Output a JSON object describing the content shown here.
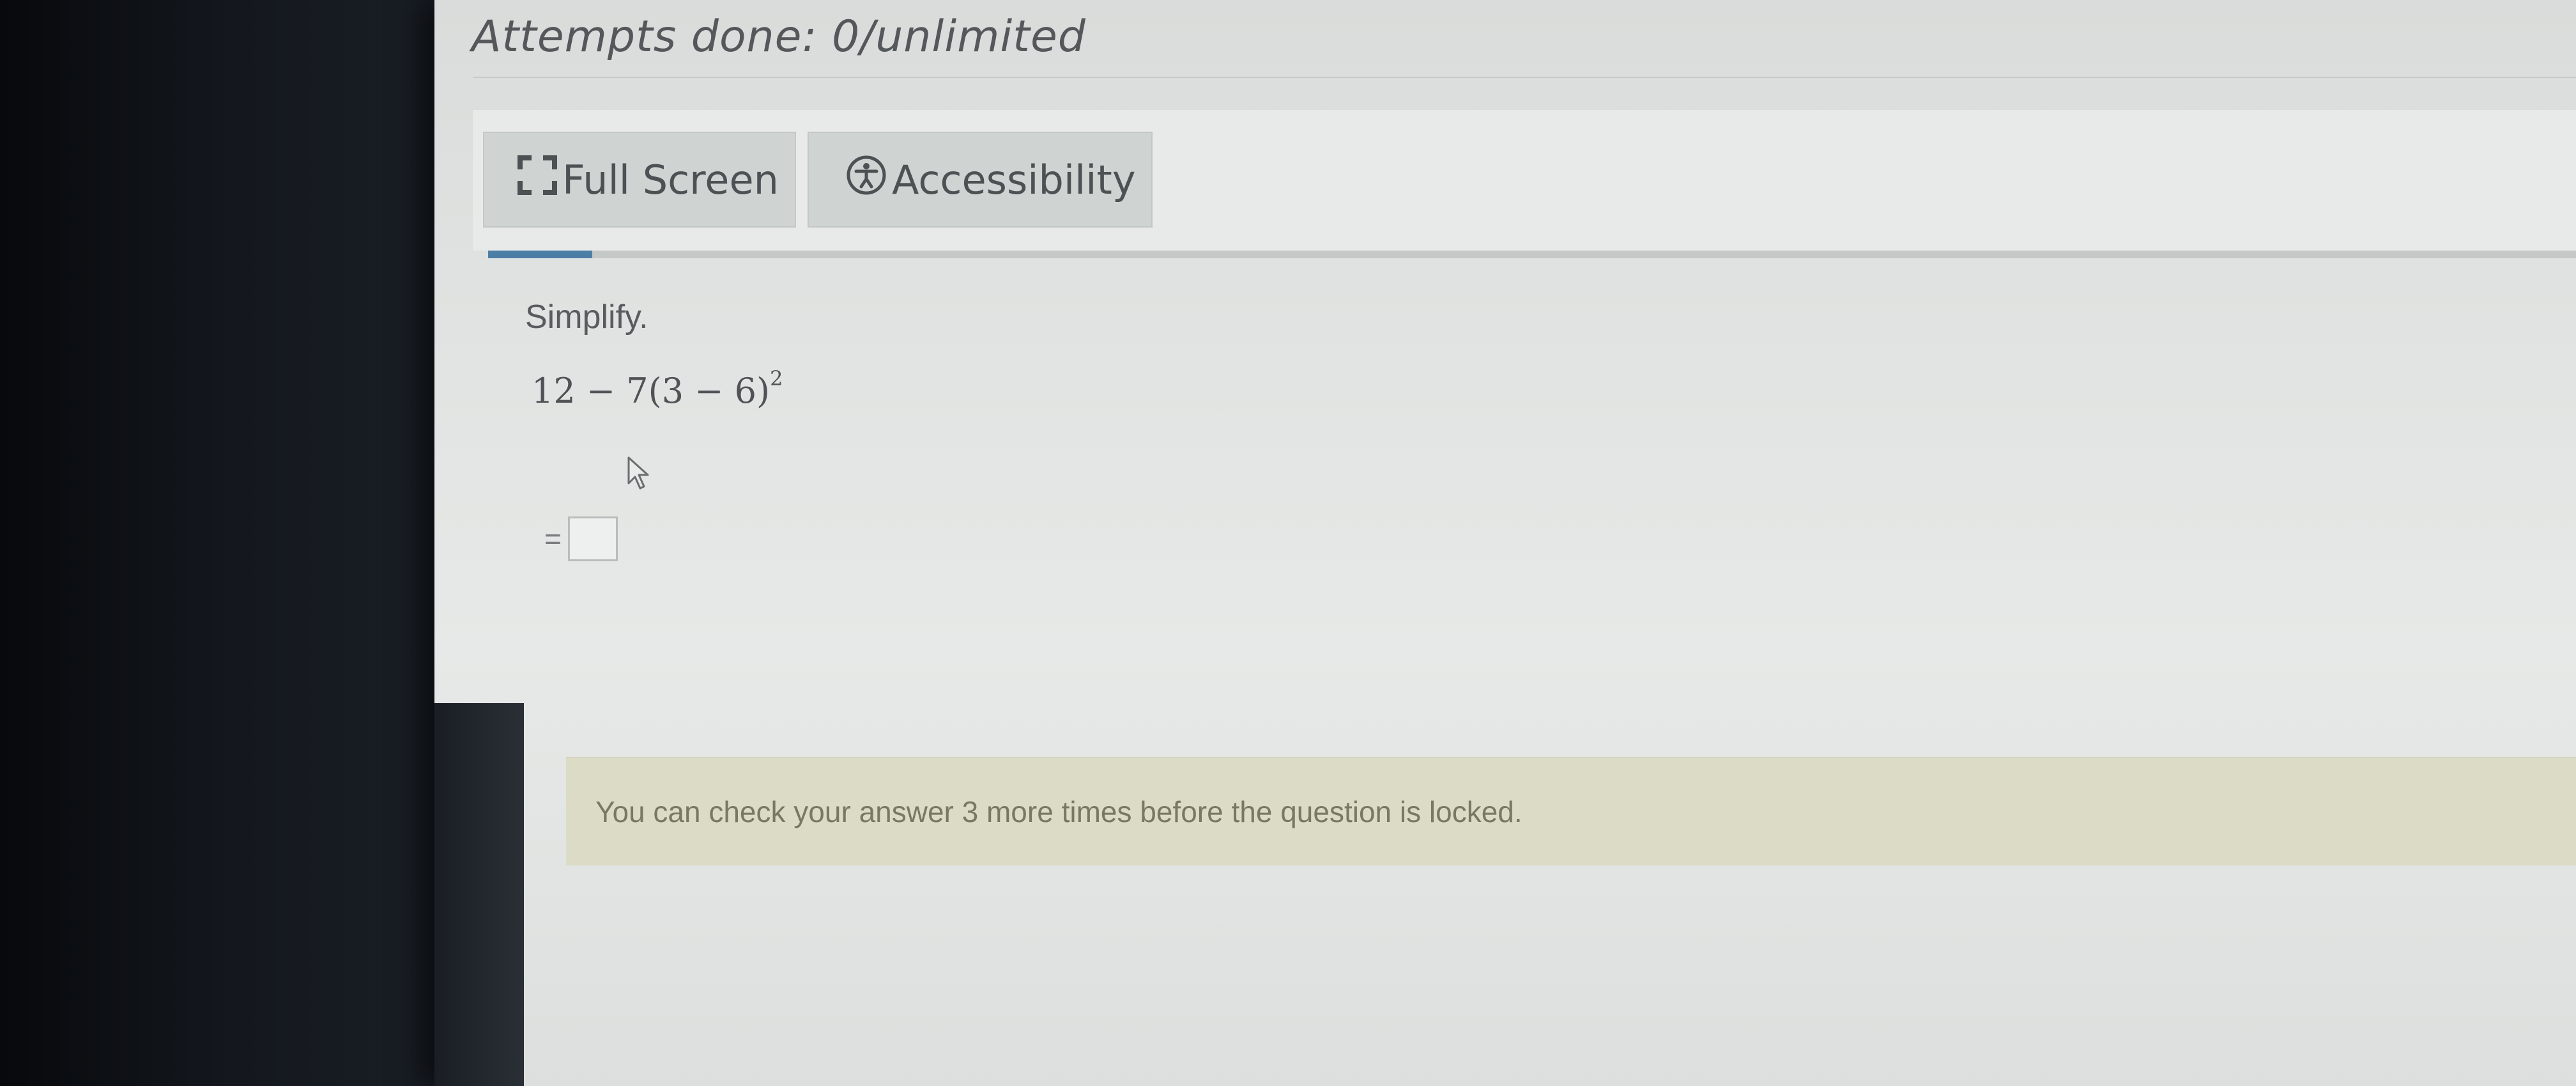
{
  "header": {
    "attempts_text": "Attempts done: 0/unlimited"
  },
  "toolbar": {
    "full_screen_label": "Full Screen",
    "full_screen_icon": "fullscreen-icon",
    "accessibility_label": "Accessibility",
    "accessibility_icon": "accessibility-icon"
  },
  "progress": {
    "fraction": 0.05,
    "color": "#4d7fa6"
  },
  "question": {
    "prompt": "Simplify.",
    "expression_base": "12 − 7(3 − 6)",
    "expression_exponent": "2",
    "equals": "="
  },
  "notice": {
    "text": "You can check your answer 3 more times before the question is locked."
  }
}
